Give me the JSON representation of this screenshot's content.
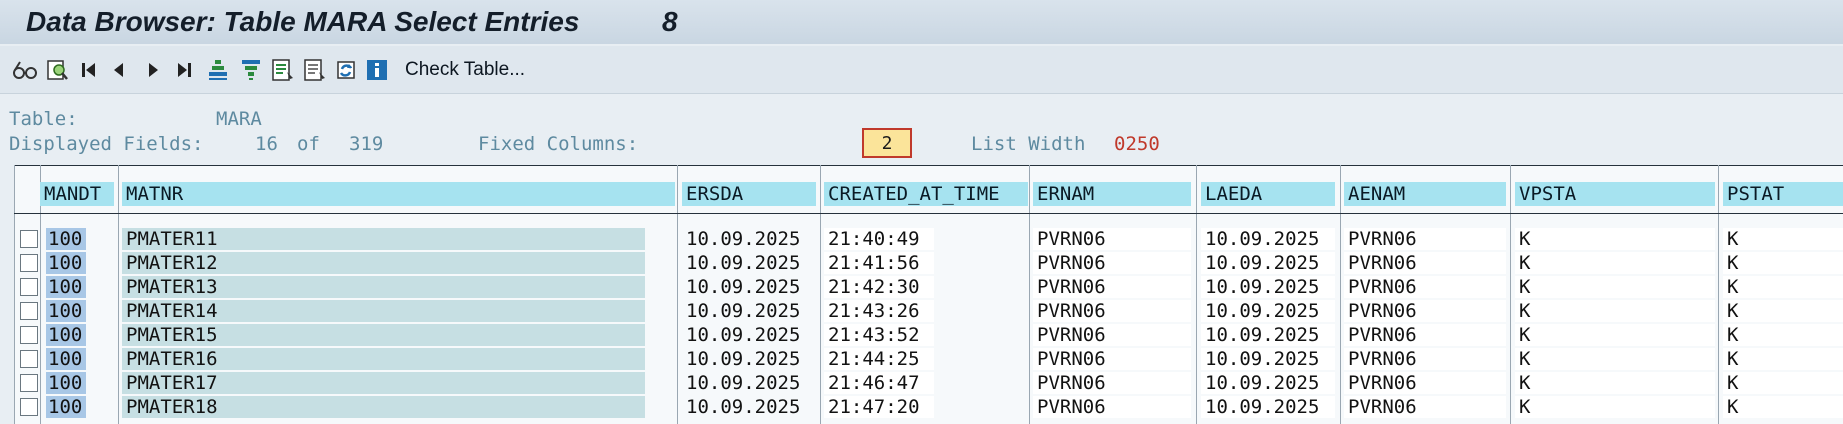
{
  "window": {
    "title": "Data Browser: Table MARA Select Entries",
    "entry_count": "8"
  },
  "toolbar": {
    "icons": [
      "glasses-icon",
      "detail-icon",
      "first-page-icon",
      "previous-page-icon",
      "next-page-icon",
      "last-page-icon",
      "sort-ascending-icon",
      "sort-descending-icon",
      "select-all-icon",
      "deselect-icon",
      "refresh-icon",
      "info-icon"
    ],
    "check_table_label": "Check Table..."
  },
  "info": {
    "table_label": "Table:",
    "table_value": "MARA",
    "displayed_fields_label": "Displayed Fields:",
    "displayed_fields_value": "16",
    "of_label": "of",
    "total_fields": "319",
    "fixed_columns_label": "Fixed Columns:",
    "fixed_columns_value": "2",
    "list_width_label": "List Width",
    "list_width_value": "0250"
  },
  "table": {
    "columns": [
      "MANDT",
      "MATNR",
      "ERSDA",
      "CREATED_AT_TIME",
      "ERNAM",
      "LAEDA",
      "AENAM",
      "VPSTA",
      "PSTAT"
    ],
    "rows": [
      [
        "100",
        "PMATER11",
        "10.09.2025",
        "21:40:49",
        "PVRN06",
        "10.09.2025",
        "PVRN06",
        "K",
        "K"
      ],
      [
        "100",
        "PMATER12",
        "10.09.2025",
        "21:41:56",
        "PVRN06",
        "10.09.2025",
        "PVRN06",
        "K",
        "K"
      ],
      [
        "100",
        "PMATER13",
        "10.09.2025",
        "21:42:30",
        "PVRN06",
        "10.09.2025",
        "PVRN06",
        "K",
        "K"
      ],
      [
        "100",
        "PMATER14",
        "10.09.2025",
        "21:43:26",
        "PVRN06",
        "10.09.2025",
        "PVRN06",
        "K",
        "K"
      ],
      [
        "100",
        "PMATER15",
        "10.09.2025",
        "21:43:52",
        "PVRN06",
        "10.09.2025",
        "PVRN06",
        "K",
        "K"
      ],
      [
        "100",
        "PMATER16",
        "10.09.2025",
        "21:44:25",
        "PVRN06",
        "10.09.2025",
        "PVRN06",
        "K",
        "K"
      ],
      [
        "100",
        "PMATER17",
        "10.09.2025",
        "21:46:47",
        "PVRN06",
        "10.09.2025",
        "PVRN06",
        "K",
        "K"
      ],
      [
        "100",
        "PMATER18",
        "10.09.2025",
        "21:47:20",
        "PVRN06",
        "10.09.2025",
        "PVRN06",
        "K",
        "K"
      ]
    ]
  }
}
